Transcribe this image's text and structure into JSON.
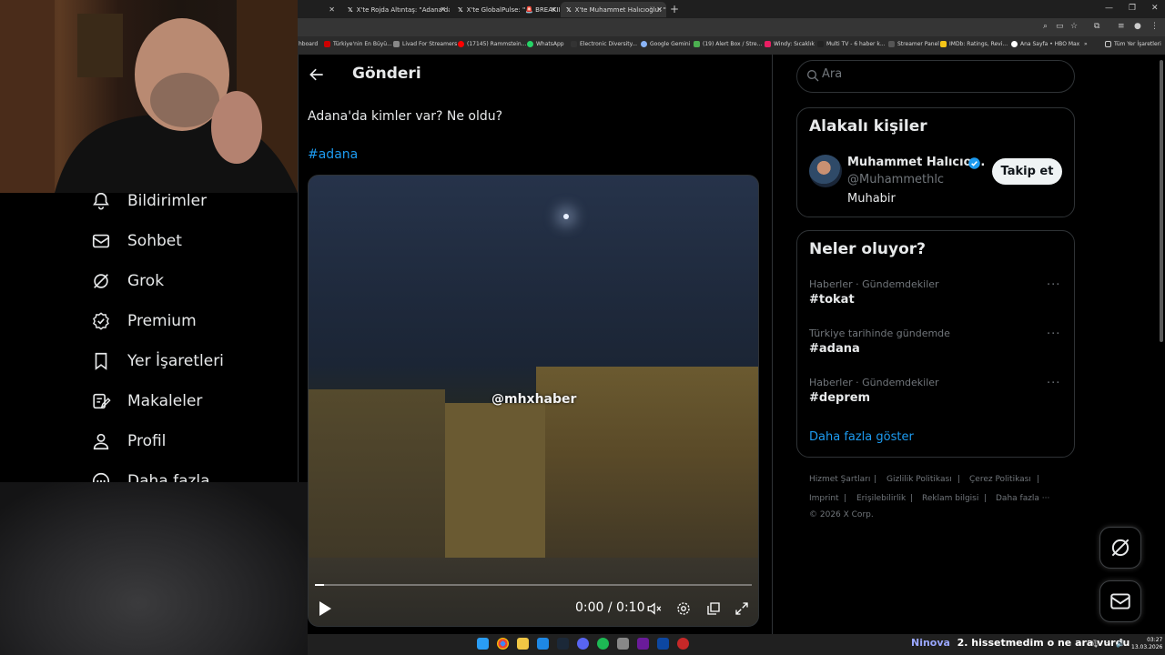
{
  "browser": {
    "tabs": [
      {
        "label": "X'te Rojda Altıntaş: \"Adana'da y...",
        "active": false
      },
      {
        "label": "X'te GlobalPulse: \"🚨 BREAKIN...",
        "active": false
      },
      {
        "label": "X'te Muhammet Halıcıoğlu: \"Ad...",
        "active": true
      }
    ],
    "bookmarks": [
      "hboard",
      "Türkiye'nin En Büyü...",
      "Livad For Streamers",
      "(17145) Rammstein...",
      "WhatsApp",
      "Electronic Diversity...",
      "Google Gemini",
      "(19) Alert Box / Stre...",
      "Windy: Sıcaklık",
      "Multi TV - 6 haber k...",
      "Streamer Panel",
      "IMDb: Ratings, Revi...",
      "Ana Sayfa • HBO Max",
      "Tüm Yer İşaretleri"
    ]
  },
  "sidebar": {
    "items": [
      {
        "label": "Bildirimler",
        "icon": "bell-icon"
      },
      {
        "label": "Sohbet",
        "icon": "mail-icon"
      },
      {
        "label": "Grok",
        "icon": "grok-icon"
      },
      {
        "label": "Premium",
        "icon": "premium-icon"
      },
      {
        "label": "Yer İşaretleri",
        "icon": "bookmark-icon"
      },
      {
        "label": "Makaleler",
        "icon": "articles-icon"
      },
      {
        "label": "Profil",
        "icon": "profile-icon"
      },
      {
        "label": "Daha fazla",
        "icon": "more-icon"
      }
    ]
  },
  "post": {
    "header_title": "Gönderi",
    "text": "Adana'da kimler var? Ne oldu?",
    "hashtag": "#adana",
    "video": {
      "watermark": "@mhxhaber",
      "time": "0:00 / 0:10",
      "progress": 0.02
    }
  },
  "search": {
    "placeholder": "Ara"
  },
  "people_card": {
    "title": "Alakalı kişiler",
    "name": "Muhammet Halıcıo...",
    "handle": "@Muhammethlc",
    "bio": "Muhabir",
    "follow_label": "Takip et"
  },
  "trends_card": {
    "title": "Neler oluyor?",
    "items": [
      {
        "context": "Haberler · Gündemdekiler",
        "tag": "#tokat"
      },
      {
        "context": "Türkiye tarihinde gündemde",
        "tag": "#adana"
      },
      {
        "context": "Haberler · Gündemdekiler",
        "tag": "#deprem"
      }
    ],
    "more_icon": "···",
    "show_more": "Daha fazla göster"
  },
  "footer": {
    "links": [
      "Hizmet Şartları",
      "|",
      "Gizlilik Politikası",
      "|",
      "Çerez Politikası",
      "|",
      "Imprint",
      "|",
      "Erişilebilirlik",
      "|",
      "Reklam bilgisi",
      "|",
      "Daha fazla ···"
    ],
    "copyright": "© 2026 X Corp."
  },
  "taskbar": {
    "ticker_user": "Ninova",
    "ticker_text": "2. hissetmedim o ne ara vurdu",
    "time": "03:27",
    "date": "13.03.2026"
  },
  "colors": {
    "accent": "#1d9bf0",
    "border": "#2f3336",
    "muted": "#71767b",
    "text": "#e7e9ea"
  }
}
